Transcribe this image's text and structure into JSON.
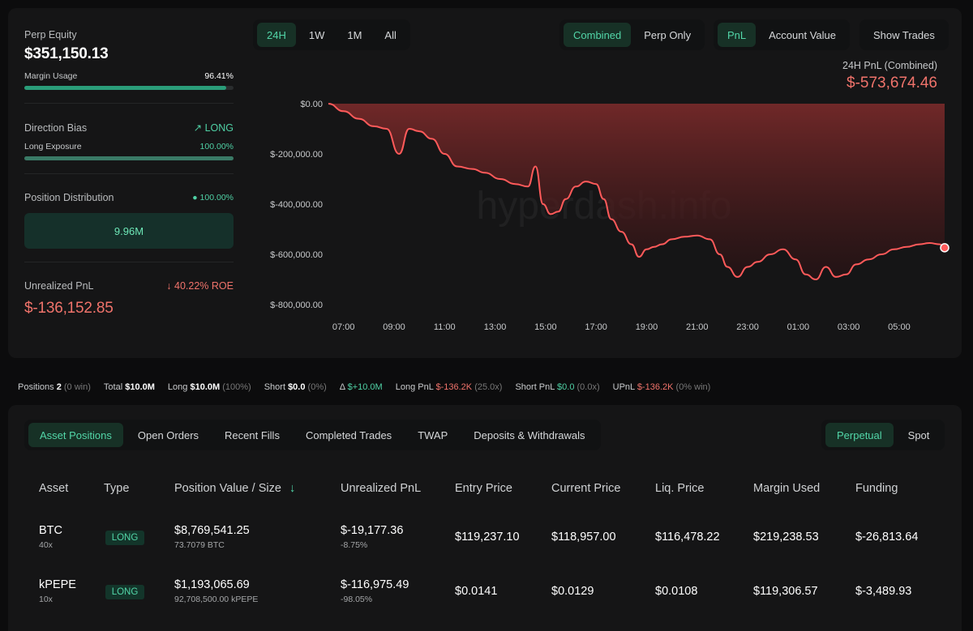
{
  "stats": {
    "perp_equity_label": "Perp Equity",
    "perp_equity_value": "$351,150.13",
    "margin_usage_label": "Margin Usage",
    "margin_usage_value": "96.41%",
    "margin_usage_fraction": 0.9641,
    "direction_bias_label": "Direction Bias",
    "direction_bias_value": "LONG",
    "long_exposure_label": "Long Exposure",
    "long_exposure_value": "100.00%",
    "long_exposure_fraction": 1.0,
    "position_distribution_label": "Position Distribution",
    "position_distribution_value": "100.00%",
    "position_distribution_bar": "9.96M",
    "unrealized_pnl_label": "Unrealized PnL",
    "unrealized_pnl_roe": "40.22% ROE",
    "unrealized_pnl_value": "$-136,152.85"
  },
  "range_tabs": [
    "24H",
    "1W",
    "1M",
    "All"
  ],
  "scope_tabs": [
    "Combined",
    "Perp Only"
  ],
  "metric_tabs": [
    "PnL",
    "Account Value"
  ],
  "show_trades_label": "Show Trades",
  "pnl_header": {
    "title": "24H PnL (Combined)",
    "value": "$-573,674.46"
  },
  "chart_data": {
    "type": "area",
    "ytick_labels": [
      "$0.00",
      "$-200,000.00",
      "$-400,000.00",
      "$-600,000.00",
      "$-800,000.00"
    ],
    "xtick_labels": [
      "07:00",
      "09:00",
      "11:00",
      "13:00",
      "15:00",
      "17:00",
      "19:00",
      "21:00",
      "23:00",
      "01:00",
      "03:00",
      "05:00"
    ],
    "ylim": [
      -800000,
      0
    ],
    "x_hours": [
      6.4,
      7.0,
      7.6,
      8.2,
      8.7,
      9.2,
      9.6,
      10.0,
      10.5,
      11.0,
      11.5,
      12.1,
      12.6,
      13.2,
      13.8,
      14.3,
      14.6,
      14.9,
      15.2,
      15.5,
      15.8,
      16.2,
      16.6,
      17.0,
      17.3,
      17.6,
      18.0,
      18.4,
      18.7,
      19.0,
      19.3,
      19.6,
      20.0,
      20.5,
      21.0,
      21.5,
      21.9,
      22.2,
      22.6,
      23.0,
      23.4,
      23.9,
      24.4,
      24.9,
      25.3,
      25.7,
      26.1,
      26.5,
      26.9,
      27.3,
      27.8,
      28.3,
      28.8,
      29.3,
      29.8,
      30.2,
      30.6,
      30.8
    ],
    "values": [
      0,
      -30000,
      -60000,
      -90000,
      -100000,
      -200000,
      -100000,
      -110000,
      -140000,
      -200000,
      -250000,
      -260000,
      -275000,
      -300000,
      -320000,
      -330000,
      -250000,
      -400000,
      -440000,
      -430000,
      -380000,
      -330000,
      -310000,
      -320000,
      -380000,
      -460000,
      -510000,
      -560000,
      -610000,
      -580000,
      -570000,
      -560000,
      -540000,
      -530000,
      -525000,
      -540000,
      -600000,
      -650000,
      -690000,
      -650000,
      -630000,
      -600000,
      -580000,
      -620000,
      -680000,
      -700000,
      -650000,
      -690000,
      -680000,
      -640000,
      -620000,
      -600000,
      -580000,
      -570000,
      -560000,
      -555000,
      -560000,
      -573674
    ]
  },
  "watermark": "hyperdash.info",
  "summary": {
    "positions_label": "Positions",
    "positions_value": "2",
    "positions_note": "(0 win)",
    "total_label": "Total",
    "total_value": "$10.0M",
    "long_label": "Long",
    "long_value": "$10.0M",
    "long_note": "(100%)",
    "short_label": "Short",
    "short_value": "$0.0",
    "short_note": "(0%)",
    "delta_label": "Δ",
    "delta_value": "$+10.0M",
    "long_pnl_label": "Long PnL",
    "long_pnl_value": "$-136.2K",
    "long_pnl_note": "(25.0x)",
    "short_pnl_label": "Short PnL",
    "short_pnl_value": "$0.0",
    "short_pnl_note": "(0.0x)",
    "upnl_label": "UPnL",
    "upnl_value": "$-136.2K",
    "upnl_note": "(0% win)"
  },
  "tabs": [
    "Asset Positions",
    "Open Orders",
    "Recent Fills",
    "Completed Trades",
    "TWAP",
    "Deposits & Withdrawals"
  ],
  "market_tabs": [
    "Perpetual",
    "Spot"
  ],
  "table": {
    "headers": [
      "Asset",
      "Type",
      "Position Value / Size",
      "Unrealized PnL",
      "Entry Price",
      "Current Price",
      "Liq. Price",
      "Margin Used",
      "Funding"
    ],
    "sort_icon": "↓",
    "rows": [
      {
        "asset": "BTC",
        "leverage": "40x",
        "type": "LONG",
        "value": "$8,769,541.25",
        "size": "73.7079 BTC",
        "upnl": "$-19,177.36",
        "upnl_pct": "-8.75%",
        "entry": "$119,237.10",
        "current": "$118,957.00",
        "liq": "$116,478.22",
        "margin": "$219,238.53",
        "funding": "$-26,813.64"
      },
      {
        "asset": "kPEPE",
        "leverage": "10x",
        "type": "LONG",
        "value": "$1,193,065.69",
        "size": "92,708,500.00 kPEPE",
        "upnl": "$-116,975.49",
        "upnl_pct": "-98.05%",
        "entry": "$0.0141",
        "current": "$0.0129",
        "liq": "$0.0108",
        "margin": "$119,306.57",
        "funding": "$-3,489.93"
      }
    ]
  },
  "colors": {
    "accent_green": "#52d6a8",
    "loss_red": "#f0736b",
    "chart_line": "#ff5a5a"
  }
}
